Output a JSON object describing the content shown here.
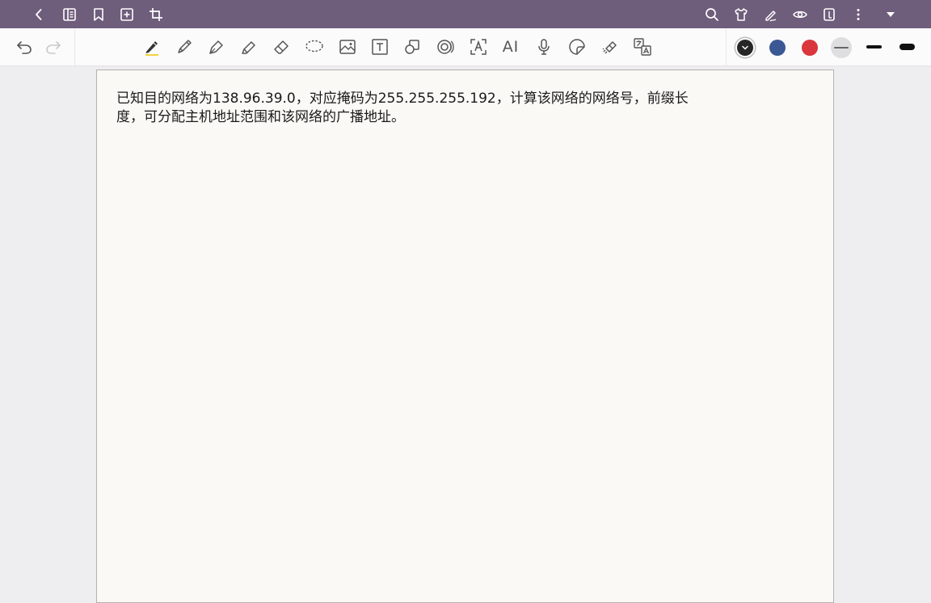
{
  "colors": {
    "topbar_bg": "#6f5d7c",
    "toolbar_bg": "#fbfbfc",
    "canvas_bg": "#eeedef",
    "page_bg": "#fbf9f5",
    "pen_underline": "#f2d23c",
    "swatch_black": "#262626",
    "swatch_blue": "#3b5894",
    "swatch_red": "#d9363e"
  },
  "topbar": {
    "left_icons": [
      "back-icon",
      "page-list-icon",
      "bookmark-icon",
      "add-page-icon",
      "crop-icon"
    ],
    "right_icons": [
      "search-icon",
      "theme-shirt-icon",
      "pen-mode-icon",
      "view-eye-icon",
      "page-view-icon",
      "more-vertical-icon",
      "collapse-triangle-icon"
    ]
  },
  "toolbar": {
    "history_icons": [
      "undo-icon",
      "redo-icon"
    ],
    "tools": [
      "pen-icon",
      "pencil-icon",
      "fountain-pen-icon",
      "highlighter-icon",
      "eraser-icon",
      "lasso-icon",
      "image-icon",
      "text-box-icon",
      "shape-icon",
      "audio-recognition-icon",
      "ocr-text-icon",
      "ai-icon",
      "microphone-icon",
      "sticker-icon",
      "tape-icon",
      "translate-icon"
    ],
    "ai_label": "AI",
    "selected_tool": "pen-icon",
    "swatches": [
      "black",
      "blue",
      "red"
    ],
    "stroke_sizes": [
      "thin",
      "medium",
      "thick"
    ]
  },
  "page": {
    "text": "已知目的网络为138.96.39.0，对应掩码为255.255.255.192，计算该网络的网络号，前缀长度，可分配主机地址范围和该网络的广播地址。"
  }
}
